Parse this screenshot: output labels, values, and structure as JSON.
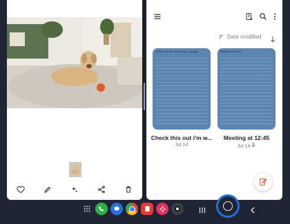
{
  "gallery": {
    "actions": [
      "favorite-icon",
      "edit-icon",
      "effects-icon",
      "share-icon",
      "delete-icon"
    ]
  },
  "notes": {
    "sort_label": "Date modified",
    "cards": [
      {
        "snippet": "Check this out i'm writing to display",
        "title": "Check this out i'm w...",
        "date": "Jul 14"
      },
      {
        "snippet": "Meeting at 12:45",
        "title": "Meeting at 12:45",
        "date": "Jul 14"
      }
    ],
    "card_color": "#5b86b1"
  },
  "dock": {
    "accent": "#1e73d6"
  }
}
